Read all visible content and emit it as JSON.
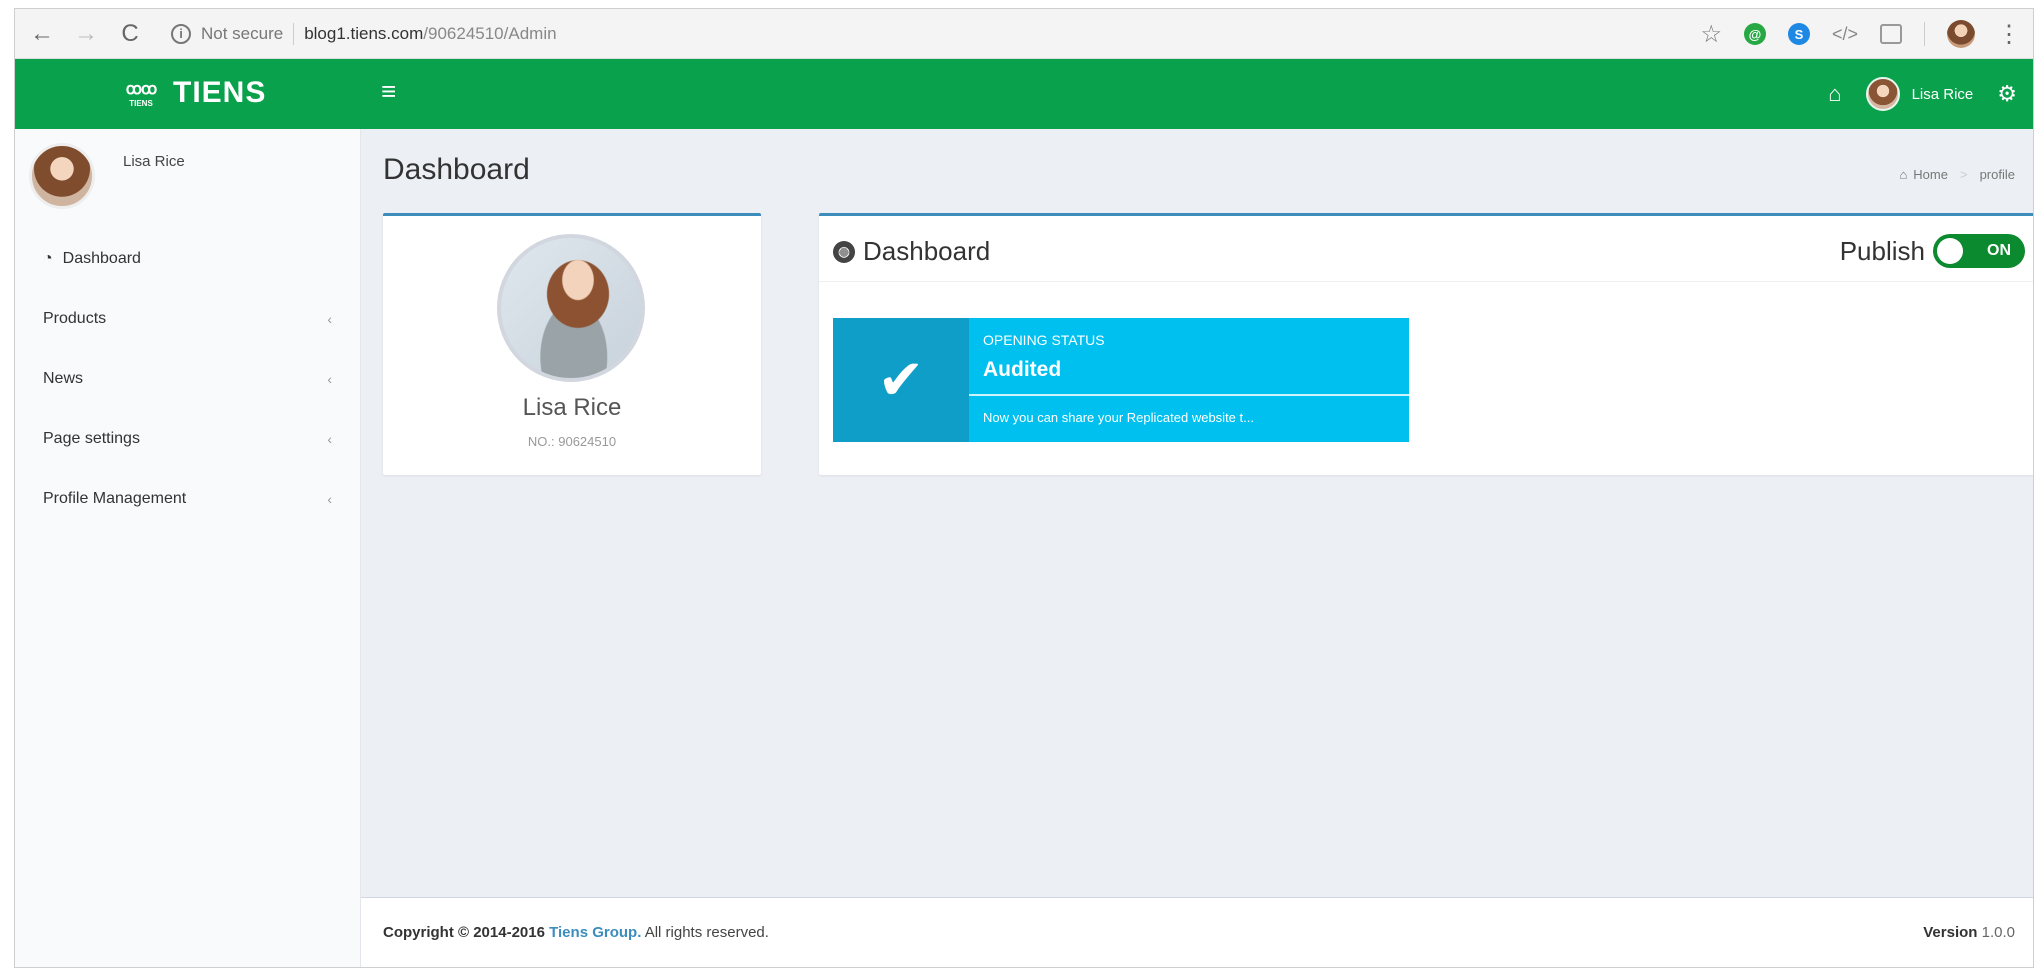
{
  "browser": {
    "not_secure": "Not secure",
    "url_host": "blog1.tiens.com",
    "url_path": "/90624510/Admin"
  },
  "topnav": {
    "brand": "TIENS",
    "brand_mini": "TIENS",
    "user_name": "Lisa Rice",
    "brand_color": "#0aa14c"
  },
  "sidebar": {
    "user_name": "Lisa Rice",
    "items": [
      {
        "label": "Dashboard",
        "icon": "dashboard-icon"
      },
      {
        "label": "Products",
        "icon": "chevron-left-icon"
      },
      {
        "label": "News",
        "icon": "chevron-left-icon"
      },
      {
        "label": "Page settings",
        "icon": "chevron-left-icon"
      },
      {
        "label": "Profile Management",
        "icon": "chevron-left-icon"
      }
    ]
  },
  "content": {
    "page_title": "Dashboard",
    "breadcrumb": [
      "Home",
      "profile"
    ]
  },
  "profile": {
    "name": "Lisa Rice",
    "number": "NO.: 90624510"
  },
  "dashboard": {
    "title": "Dashboard",
    "publish_label": "Publish",
    "toggle_state": "ON",
    "status_label": "OPENING STATUS",
    "status_value": "Audited",
    "status_desc": "Now you can share your Replicated website t...",
    "accent_color": "#00c0ef"
  },
  "footer": {
    "copyright_prefix": "Copyright © 2014-2016",
    "company": "Tiens Group.",
    "rights": "All rights reserved.",
    "version_label": "Version",
    "version_value": "1.0.0"
  }
}
